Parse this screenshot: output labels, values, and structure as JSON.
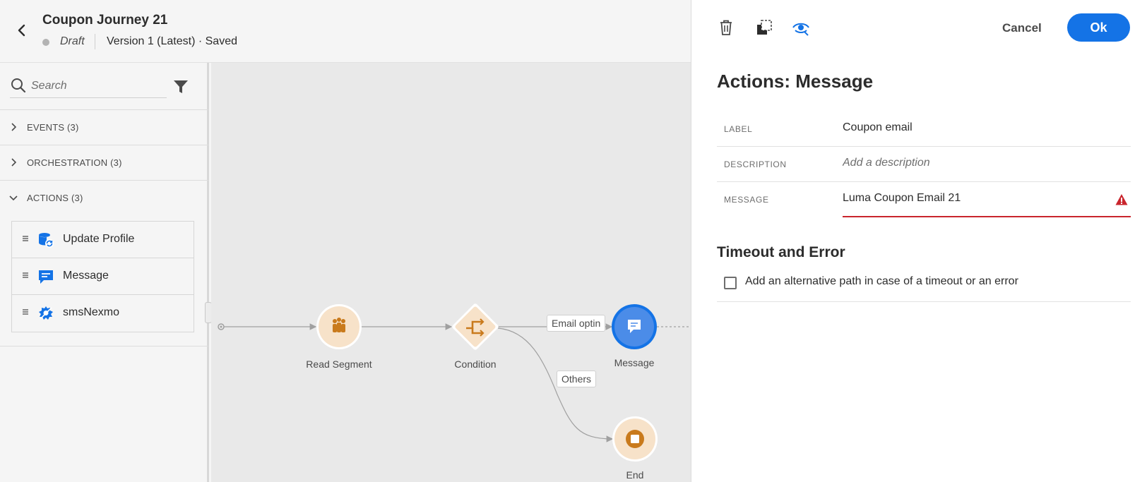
{
  "header": {
    "title": "Coupon Journey 21",
    "status": "Draft",
    "version": "Version 1 (Latest) · Saved"
  },
  "sidebar": {
    "search_placeholder": "Search",
    "categories": [
      {
        "label": "EVENTS (3)",
        "expanded": false
      },
      {
        "label": "ORCHESTRATION (3)",
        "expanded": false
      },
      {
        "label": "ACTIONS (3)",
        "expanded": true
      }
    ],
    "actions": [
      {
        "label": "Update Profile",
        "icon": "update-profile-icon"
      },
      {
        "label": "Message",
        "icon": "message-icon"
      },
      {
        "label": "smsNexmo",
        "icon": "custom-action-icon"
      }
    ]
  },
  "canvas": {
    "nodes": [
      {
        "label": "Read Segment",
        "icon": "segment-icon"
      },
      {
        "label": "Condition",
        "icon": "condition-icon"
      },
      {
        "label": "Message",
        "icon": "message-icon",
        "selected": true
      },
      {
        "label": "End",
        "icon": "end-icon"
      }
    ],
    "edge_labels": [
      "Email optin",
      "Others"
    ]
  },
  "panel": {
    "toolbar": {
      "cancel": "Cancel",
      "ok": "Ok"
    },
    "title": "Actions: Message",
    "fields": {
      "label": {
        "name": "LABEL",
        "value": "Coupon email"
      },
      "description": {
        "name": "DESCRIPTION",
        "placeholder": "Add a description"
      },
      "message": {
        "name": "MESSAGE",
        "value": "Luma Coupon Email 21",
        "error": true
      }
    },
    "timeout_section": {
      "title": "Timeout and Error",
      "checkbox_label": "Add an alternative path in case of a timeout or an error",
      "checked": false
    }
  },
  "colors": {
    "accent": "#1473e6",
    "node_fill": "#f7e2c9",
    "node_icon": "#c97a1c",
    "error": "#c9252d"
  }
}
